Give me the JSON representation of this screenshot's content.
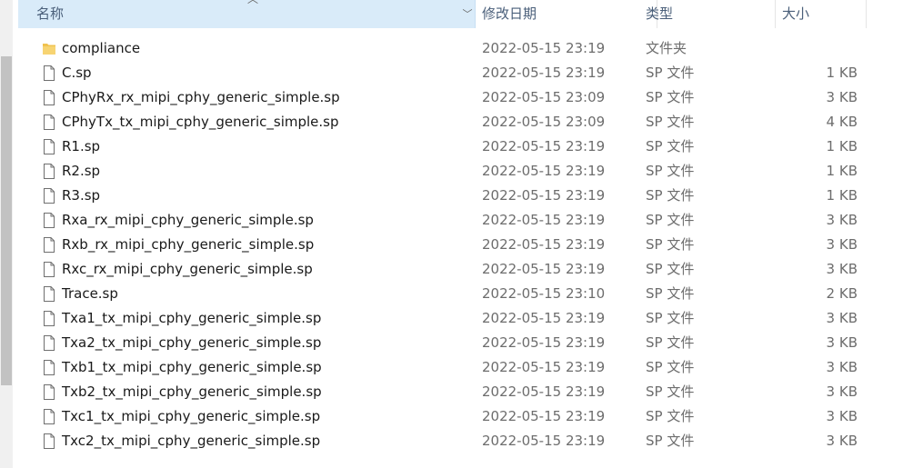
{
  "header": {
    "name": "名称",
    "date": "修改日期",
    "type": "类型",
    "size": "大小",
    "sort_icon": "sort-up-icon",
    "dropdown_icon": "chevron-down-icon"
  },
  "colors": {
    "header_bg": "#d9ebf9",
    "header_text": "#4a5f7a",
    "folder": "#f0c24f",
    "secondary_text": "#6d6d6d"
  },
  "files": [
    {
      "name": "compliance",
      "date": "2022-05-15 23:19",
      "type": "文件夹",
      "size": "",
      "icon": "folder-icon"
    },
    {
      "name": "C.sp",
      "date": "2022-05-15 23:19",
      "type": "SP 文件",
      "size": "1 KB",
      "icon": "file-icon"
    },
    {
      "name": "CPhyRx_rx_mipi_cphy_generic_simple.sp",
      "date": "2022-05-15 23:09",
      "type": "SP 文件",
      "size": "3 KB",
      "icon": "file-icon"
    },
    {
      "name": "CPhyTx_tx_mipi_cphy_generic_simple.sp",
      "date": "2022-05-15 23:09",
      "type": "SP 文件",
      "size": "4 KB",
      "icon": "file-icon"
    },
    {
      "name": "R1.sp",
      "date": "2022-05-15 23:19",
      "type": "SP 文件",
      "size": "1 KB",
      "icon": "file-icon"
    },
    {
      "name": "R2.sp",
      "date": "2022-05-15 23:19",
      "type": "SP 文件",
      "size": "1 KB",
      "icon": "file-icon"
    },
    {
      "name": "R3.sp",
      "date": "2022-05-15 23:19",
      "type": "SP 文件",
      "size": "1 KB",
      "icon": "file-icon"
    },
    {
      "name": "Rxa_rx_mipi_cphy_generic_simple.sp",
      "date": "2022-05-15 23:19",
      "type": "SP 文件",
      "size": "3 KB",
      "icon": "file-icon"
    },
    {
      "name": "Rxb_rx_mipi_cphy_generic_simple.sp",
      "date": "2022-05-15 23:19",
      "type": "SP 文件",
      "size": "3 KB",
      "icon": "file-icon"
    },
    {
      "name": "Rxc_rx_mipi_cphy_generic_simple.sp",
      "date": "2022-05-15 23:19",
      "type": "SP 文件",
      "size": "3 KB",
      "icon": "file-icon"
    },
    {
      "name": "Trace.sp",
      "date": "2022-05-15 23:10",
      "type": "SP 文件",
      "size": "2 KB",
      "icon": "file-icon"
    },
    {
      "name": "Txa1_tx_mipi_cphy_generic_simple.sp",
      "date": "2022-05-15 23:19",
      "type": "SP 文件",
      "size": "3 KB",
      "icon": "file-icon"
    },
    {
      "name": "Txa2_tx_mipi_cphy_generic_simple.sp",
      "date": "2022-05-15 23:19",
      "type": "SP 文件",
      "size": "3 KB",
      "icon": "file-icon"
    },
    {
      "name": "Txb1_tx_mipi_cphy_generic_simple.sp",
      "date": "2022-05-15 23:19",
      "type": "SP 文件",
      "size": "3 KB",
      "icon": "file-icon"
    },
    {
      "name": "Txb2_tx_mipi_cphy_generic_simple.sp",
      "date": "2022-05-15 23:19",
      "type": "SP 文件",
      "size": "3 KB",
      "icon": "file-icon"
    },
    {
      "name": "Txc1_tx_mipi_cphy_generic_simple.sp",
      "date": "2022-05-15 23:19",
      "type": "SP 文件",
      "size": "3 KB",
      "icon": "file-icon"
    },
    {
      "name": "Txc2_tx_mipi_cphy_generic_simple.sp",
      "date": "2022-05-15 23:19",
      "type": "SP 文件",
      "size": "3 KB",
      "icon": "file-icon"
    }
  ]
}
